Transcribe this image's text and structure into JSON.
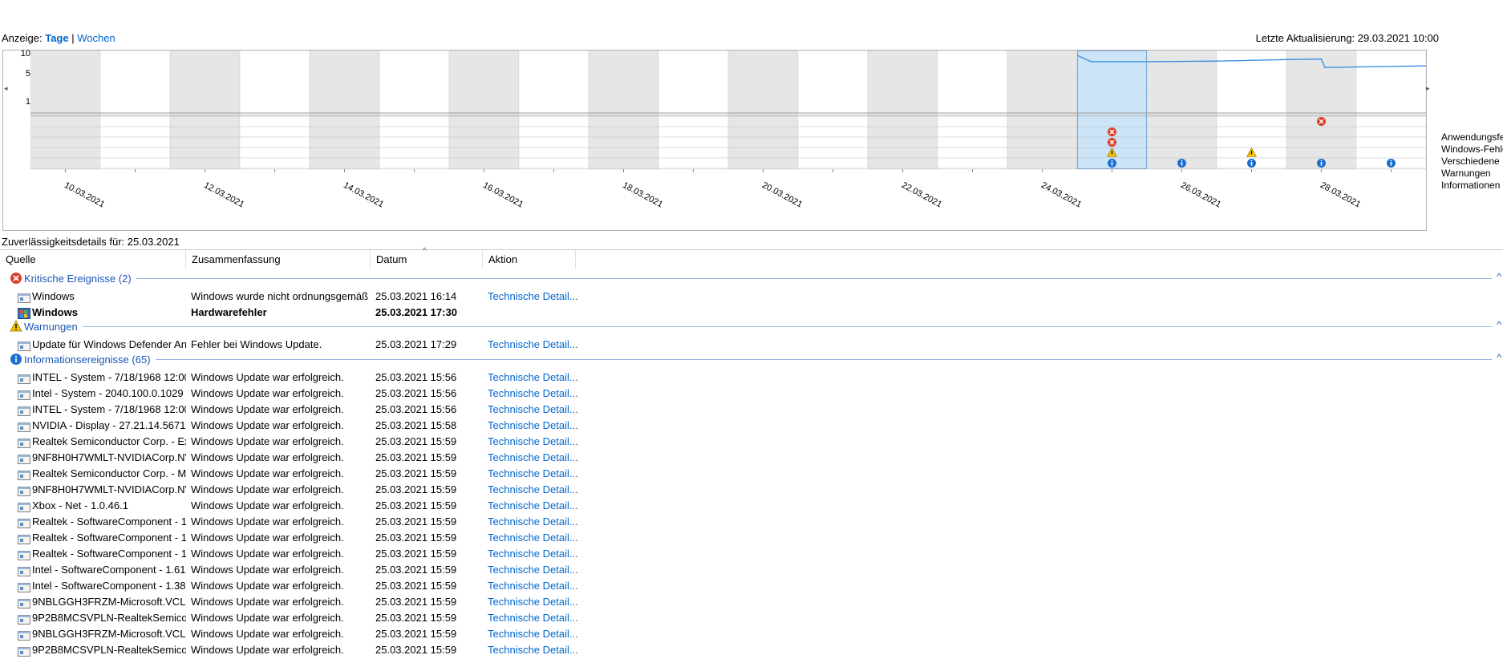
{
  "view": {
    "label": "Anzeige:",
    "days": "Tage",
    "separator": "|",
    "weeks": "Wochen"
  },
  "last_update": "Letzte Aktualisierung: 29.03.2021 10:00",
  "chart": {
    "y_labels": [
      "10",
      "5",
      "1"
    ],
    "dates": [
      "10.03.2021",
      "12.03.2021",
      "14.03.2021",
      "16.03.2021",
      "18.03.2021",
      "20.03.2021",
      "22.03.2021",
      "24.03.2021",
      "26.03.2021",
      "28.03.2021"
    ],
    "legend": [
      "Anwendungsfehler",
      "Windows-Fehler",
      "Verschiedene Fehler",
      "Warnungen",
      "Informationen"
    ],
    "nav_left": "◂",
    "nav_right": "▸"
  },
  "chart_data": {
    "type": "line",
    "columns": 20,
    "selected_column": 15,
    "ylim": [
      0,
      10
    ],
    "stability_index": [
      {
        "col": 15.0,
        "value": 10.0
      },
      {
        "col": 15.2,
        "value": 8.8
      },
      {
        "col": 16.0,
        "value": 8.8
      },
      {
        "col": 17.0,
        "value": 8.9
      },
      {
        "col": 18.0,
        "value": 9.2
      },
      {
        "col": 18.5,
        "value": 9.3
      },
      {
        "col": 18.55,
        "value": 7.7
      },
      {
        "col": 19.5,
        "value": 7.9
      },
      {
        "col": 20.0,
        "value": 8.0
      }
    ],
    "markers": [
      {
        "col": 18,
        "row": 0,
        "kind": "error"
      },
      {
        "col": 15,
        "row": 1,
        "kind": "error"
      },
      {
        "col": 15,
        "row": 2,
        "kind": "error"
      },
      {
        "col": 15,
        "row": 3,
        "kind": "warning"
      },
      {
        "col": 17,
        "row": 3,
        "kind": "warning"
      },
      {
        "col": 15,
        "row": 4,
        "kind": "info"
      },
      {
        "col": 16,
        "row": 4,
        "kind": "info"
      },
      {
        "col": 17,
        "row": 4,
        "kind": "info"
      },
      {
        "col": 18,
        "row": 4,
        "kind": "info"
      },
      {
        "col": 19,
        "row": 4,
        "kind": "info"
      }
    ]
  },
  "details": {
    "caption": "Zuverlässigkeitsdetails für: 25.03.2021",
    "columns": [
      "Quelle",
      "Zusammenfassung",
      "Datum",
      "Aktion"
    ],
    "sort_caret": "^",
    "collapse_glyph": "^",
    "groups": [
      {
        "label": "Kritische Ereignisse (2)",
        "icon": "error-icon",
        "rows": [
          {
            "source": "Windows",
            "summary": "Windows wurde nicht ordnungsgemäß ...",
            "date": "25.03.2021 16:14",
            "action": "Technische Detail...",
            "bold": false,
            "icon": "app-icon"
          },
          {
            "source": "Windows",
            "summary": "Hardwarefehler",
            "date": "25.03.2021 17:30",
            "action": "",
            "bold": true,
            "icon": "windows-shield-icon"
          }
        ]
      },
      {
        "label": "Warnungen",
        "icon": "warning-icon",
        "rows": [
          {
            "source": "Update für Windows Defender Ant...",
            "summary": "Fehler bei Windows Update.",
            "date": "25.03.2021 17:29",
            "action": "Technische Detail...",
            "bold": false,
            "icon": "app-icon"
          }
        ]
      },
      {
        "label": "Informationsereignisse (65)",
        "icon": "info-icon",
        "rows": [
          {
            "source": "INTEL - System - 7/18/1968 12:00:0...",
            "summary": "Windows Update war erfolgreich.",
            "date": "25.03.2021 15:56",
            "action": "Technische Detail...",
            "bold": false,
            "icon": "app-icon"
          },
          {
            "source": "Intel - System - 2040.100.0.1029",
            "summary": "Windows Update war erfolgreich.",
            "date": "25.03.2021 15:56",
            "action": "Technische Detail...",
            "bold": false,
            "icon": "app-icon"
          },
          {
            "source": "INTEL - System - 7/18/1968 12:00:0...",
            "summary": "Windows Update war erfolgreich.",
            "date": "25.03.2021 15:56",
            "action": "Technische Detail...",
            "bold": false,
            "icon": "app-icon"
          },
          {
            "source": "NVIDIA - Display - 27.21.14.5671",
            "summary": "Windows Update war erfolgreich.",
            "date": "25.03.2021 15:58",
            "action": "Technische Detail...",
            "bold": false,
            "icon": "app-icon"
          },
          {
            "source": "Realtek Semiconductor Corp. - Ext...",
            "summary": "Windows Update war erfolgreich.",
            "date": "25.03.2021 15:59",
            "action": "Technische Detail...",
            "bold": false,
            "icon": "app-icon"
          },
          {
            "source": "9NF8H0H7WMLT-NVIDIACorp.NVI...",
            "summary": "Windows Update war erfolgreich.",
            "date": "25.03.2021 15:59",
            "action": "Technische Detail...",
            "bold": false,
            "icon": "app-icon"
          },
          {
            "source": "Realtek Semiconductor Corp. - M...",
            "summary": "Windows Update war erfolgreich.",
            "date": "25.03.2021 15:59",
            "action": "Technische Detail...",
            "bold": false,
            "icon": "app-icon"
          },
          {
            "source": "9NF8H0H7WMLT-NVIDIACorp.NVI...",
            "summary": "Windows Update war erfolgreich.",
            "date": "25.03.2021 15:59",
            "action": "Technische Detail...",
            "bold": false,
            "icon": "app-icon"
          },
          {
            "source": "Xbox - Net - 1.0.46.1",
            "summary": "Windows Update war erfolgreich.",
            "date": "25.03.2021 15:59",
            "action": "Technische Detail...",
            "bold": false,
            "icon": "app-icon"
          },
          {
            "source": "Realtek - SoftwareComponent - 1....",
            "summary": "Windows Update war erfolgreich.",
            "date": "25.03.2021 15:59",
            "action": "Technische Detail...",
            "bold": false,
            "icon": "app-icon"
          },
          {
            "source": "Realtek - SoftwareComponent - 1....",
            "summary": "Windows Update war erfolgreich.",
            "date": "25.03.2021 15:59",
            "action": "Technische Detail...",
            "bold": false,
            "icon": "app-icon"
          },
          {
            "source": "Realtek - SoftwareComponent - 1....",
            "summary": "Windows Update war erfolgreich.",
            "date": "25.03.2021 15:59",
            "action": "Technische Detail...",
            "bold": false,
            "icon": "app-icon"
          },
          {
            "source": "Intel - SoftwareComponent - 1.61....",
            "summary": "Windows Update war erfolgreich.",
            "date": "25.03.2021 15:59",
            "action": "Technische Detail...",
            "bold": false,
            "icon": "app-icon"
          },
          {
            "source": "Intel - SoftwareComponent - 1.38....",
            "summary": "Windows Update war erfolgreich.",
            "date": "25.03.2021 15:59",
            "action": "Technische Detail...",
            "bold": false,
            "icon": "app-icon"
          },
          {
            "source": "9NBLGGH3FRZM-Microsoft.VCLib...",
            "summary": "Windows Update war erfolgreich.",
            "date": "25.03.2021 15:59",
            "action": "Technische Detail...",
            "bold": false,
            "icon": "app-icon"
          },
          {
            "source": "9P2B8MCSVPLN-RealtekSemicon...",
            "summary": "Windows Update war erfolgreich.",
            "date": "25.03.2021 15:59",
            "action": "Technische Detail...",
            "bold": false,
            "icon": "app-icon"
          },
          {
            "source": "9NBLGGH3FRZM-Microsoft.VCLib...",
            "summary": "Windows Update war erfolgreich.",
            "date": "25.03.2021 15:59",
            "action": "Technische Detail...",
            "bold": false,
            "icon": "app-icon"
          },
          {
            "source": "9P2B8MCSVPLN-RealtekSemicon...",
            "summary": "Windows Update war erfolgreich.",
            "date": "25.03.2021 15:59",
            "action": "Technische Detail...",
            "bold": false,
            "icon": "app-icon"
          }
        ]
      }
    ]
  },
  "colors": {
    "shaded_column": "#e6e6e6",
    "selected_column": "#cce4f7",
    "selected_border": "#5a8fc7",
    "stability_line": "#3b8fe0",
    "error": "#d9402a",
    "warning": "#f3c400",
    "info": "#1a6fcf",
    "link": "#0066cc",
    "group_label": "#1a56b6"
  }
}
